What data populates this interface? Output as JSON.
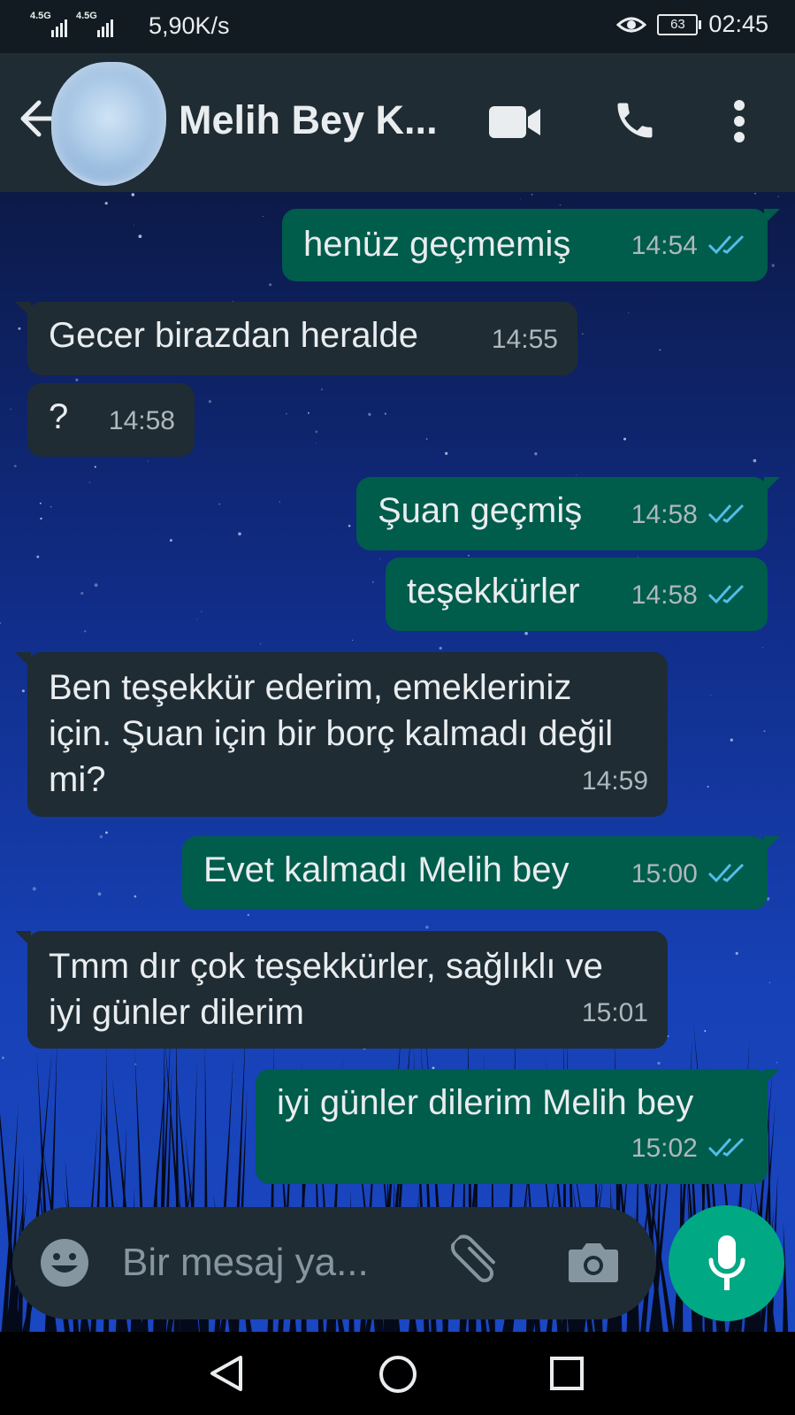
{
  "status_bar": {
    "sim1": "4.5G",
    "sim2": "4.5G",
    "speed": "5,90K/s",
    "battery": "63",
    "time": "02:45",
    "icons": [
      "signal-icon",
      "eye-icon",
      "battery-icon"
    ]
  },
  "header": {
    "contact_name": "Melih Bey K...",
    "icons": [
      "back-arrow-icon",
      "video-call-icon",
      "phone-icon",
      "more-options-icon"
    ]
  },
  "messages": [
    {
      "dir": "out",
      "text": "henüz geçmemiş",
      "time": "14:54"
    },
    {
      "dir": "in",
      "text": "Gecer birazdan heralde",
      "time": "14:55"
    },
    {
      "dir": "in",
      "text": "?",
      "time": "14:58"
    },
    {
      "dir": "out",
      "text": "Şuan geçmiş",
      "time": "14:58"
    },
    {
      "dir": "out",
      "text": "teşekkürler",
      "time": "14:58"
    },
    {
      "dir": "in",
      "text": "Ben teşekkür ederim, emekleriniz için. Şuan için bir borç kalmadı değil mi?",
      "time": "14:59"
    },
    {
      "dir": "out",
      "text": "Evet kalmadı Melih bey",
      "time": "15:00"
    },
    {
      "dir": "in",
      "text": "Tmm dır çok teşekkürler, sağlıklı ve iyi günler dilerim",
      "time": "15:01"
    },
    {
      "dir": "out",
      "text": "iyi günler dilerim Melih bey",
      "time": "15:02"
    }
  ],
  "input": {
    "placeholder": "Bir mesaj ya...",
    "icons": [
      "emoji-icon",
      "attach-icon",
      "camera-icon",
      "mic-icon"
    ]
  },
  "nav_bar": {
    "icons": [
      "back-triangle-icon",
      "home-circle-icon",
      "recents-square-icon"
    ]
  },
  "colors": {
    "outgoing_bubble": "#005c4b",
    "incoming_bubble": "#1f2c34",
    "accent": "#00a884",
    "read_ticks": "#53bdeb"
  }
}
